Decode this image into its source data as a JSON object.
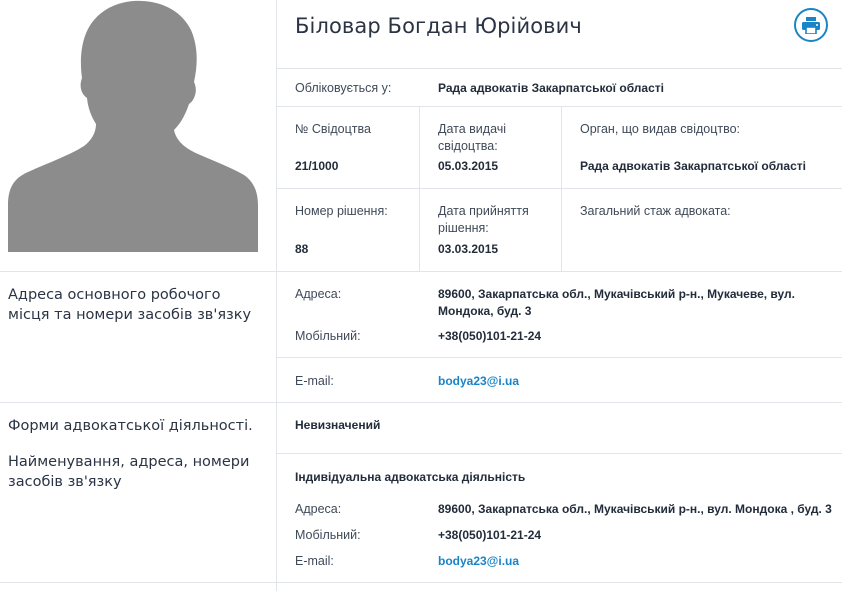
{
  "profile": {
    "name": "Біловар Богдан Юрійович",
    "registered_label": "Обліковується у:",
    "registered_value": "Рада адвокатів Закарпатської області"
  },
  "certificate": {
    "number_label": "№ Свідоцтва",
    "number_value": "21/1000",
    "issue_date_label": "Дата видачі свідоцтва:",
    "issue_date_value": "05.03.2015",
    "issuer_label": "Орган, що видав свідоцтво:",
    "issuer_value": "Рада адвокатів Закарпатської області"
  },
  "decision": {
    "number_label": "Номер рішення:",
    "number_value": "88",
    "date_label": "Дата прийняття рішення:",
    "date_value": "03.03.2015",
    "experience_label": "Загальний стаж адвоката:"
  },
  "work_address": {
    "section_title": "Адреса основного робочого місця та номери засобів зв'язку",
    "address_label": "Адреса:",
    "address_value": "89600, Закарпатська обл., Мукачівський р-н., Мукачеве, вул. Мондока, буд. 3",
    "mobile_label": "Мобільний:",
    "mobile_value": "+38(050)101-21-24",
    "email_label": "E-mail:",
    "email_value": "bodya23@i.ua"
  },
  "practice": {
    "section_title_1": "Форми адвокатської діяльності.",
    "section_title_2": "Найменування, адреса, номери засобів зв'язку",
    "form_undefined": "Невизначений",
    "form_individual": "Індивідуальна адвокатська діяльність",
    "address_label": "Адреса:",
    "address_value": "89600, Закарпатська обл., Мукачівський р-н., вул. Мондока , буд. 3",
    "mobile_label": "Мобільний:",
    "mobile_value": "+38(050)101-21-24",
    "email_label": "E-mail:",
    "email_value": "bodya23@i.ua"
  },
  "icons": {
    "avatar": "person-silhouette",
    "print": "printer-icon"
  },
  "colors": {
    "accent": "#1a84c7",
    "silhouette": "#8c8c8c",
    "divider": "#e1e5ea"
  }
}
